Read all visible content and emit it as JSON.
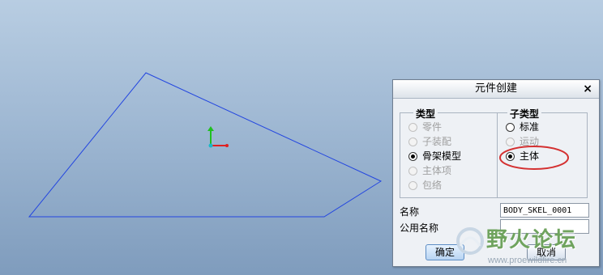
{
  "dialog": {
    "title": "元件创建",
    "close_symbol": "×",
    "type_group": {
      "legend": "类型",
      "options": [
        {
          "label": "零件",
          "state": "disabled"
        },
        {
          "label": "子装配",
          "state": "disabled"
        },
        {
          "label": "骨架模型",
          "state": "checked"
        },
        {
          "label": "主体项",
          "state": "disabled"
        },
        {
          "label": "包络",
          "state": "disabled"
        }
      ]
    },
    "subtype_group": {
      "legend": "子类型",
      "options": [
        {
          "label": "标准",
          "state": "enabled"
        },
        {
          "label": "运动",
          "state": "disabled"
        },
        {
          "label": "主体",
          "state": "checked"
        }
      ]
    },
    "name_label": "名称",
    "name_value": "BODY_SKEL_0001",
    "common_name_label": "公用名称",
    "common_name_value": "",
    "ok_label": "确定",
    "cancel_label": "取消"
  },
  "watermark": {
    "text": "野火论坛",
    "url": "www.proewildfire.cn"
  },
  "colors": {
    "model_edge": "#2346e0",
    "highlight_ellipse": "#d43030",
    "axis_x": "#e02020",
    "axis_y": "#20c020",
    "axis_origin": "#18b8c8"
  }
}
